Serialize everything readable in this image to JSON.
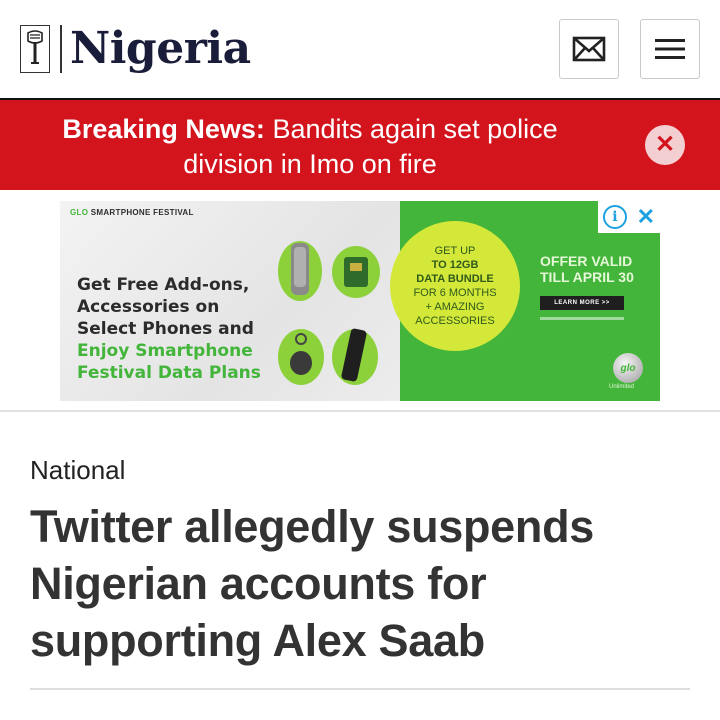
{
  "header": {
    "logo_text": "Nigeria",
    "mail_icon": "mail-icon",
    "menu_icon": "hamburger-menu-icon"
  },
  "breaking": {
    "label": "Breaking News:",
    "text": " Bandits again set police division in Imo on fire",
    "close_icon": "close-icon",
    "bg_color": "#d3141d"
  },
  "ad": {
    "tag_brand": "GLO",
    "tag_rest": " SMARTPHONE FESTIVAL",
    "copy_line1": "Get Free Add-ons,",
    "copy_line2": "Accessories on",
    "copy_line3": "Select Phones and",
    "copy_green1": "Enjoy Smartphone",
    "copy_green2": "Festival Data Plans",
    "circle_line1": "GET UP",
    "circle_line2": "TO 12GB",
    "circle_line3": "DATA BUNDLE",
    "circle_line4": "FOR 6 MONTHS",
    "circle_line5": "+ AMAZING",
    "circle_line6": "ACCESSORIES",
    "offer_line1": "OFFER VALID",
    "offer_line2": "TILL APRIL 30",
    "learn_more": "LEARN MORE >>",
    "glo_logo": "glo",
    "glo_sub": "Unlimited",
    "accent_color": "#43b53a"
  },
  "article": {
    "category": "National",
    "headline": "Twitter allegedly suspends Nigerian accounts for supporting Alex Saab"
  }
}
